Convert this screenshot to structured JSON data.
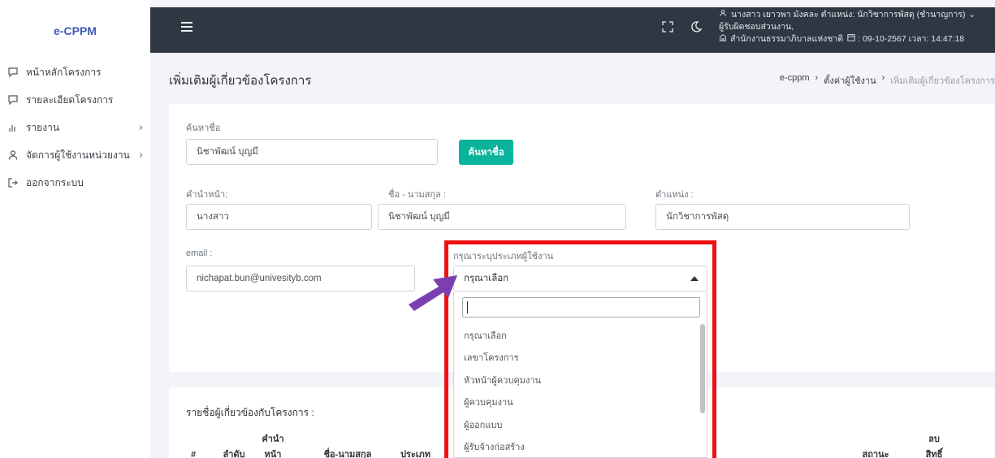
{
  "sidebar": {
    "brand": "e-CPPM",
    "items": [
      {
        "label": "หน้าหลักโครงการ",
        "icon": "chat-icon",
        "chevron": ""
      },
      {
        "label": "รายละเอียดโครงการ",
        "icon": "chat-icon",
        "chevron": ""
      },
      {
        "label": "รายงาน",
        "icon": "bar-chart-icon",
        "chevron": "›"
      },
      {
        "label": "จัดการผู้ใช้งานหน่วยงาน",
        "icon": "user-icon",
        "chevron": "›"
      },
      {
        "label": "ออกจากระบบ",
        "icon": "logout-icon",
        "chevron": ""
      }
    ]
  },
  "topbar": {
    "user_line1": "นางสาว เยาวพา มังคละ ตำแหน่ง: นักวิชาการพัสดุ (ชำนาญการ)",
    "user_line2": "ผู้รับผิดชอบส่วนงาน,",
    "user_line3": "สำนักงานธรรมาภิบาลแห่งชาติ",
    "date": "09-10-2567",
    "time_label": "เวลา: 14:47:18"
  },
  "page": {
    "title": "เพิ่มเติมผู้เกี่ยวข้องโครงการ",
    "breadcrumb": [
      "e-cppm",
      "ตั้งค่าผู้ใช้งาน",
      "เพิ่มเติมผู้เกี่ยวข้องโครงการ"
    ]
  },
  "form": {
    "search_label": "ค้นหาชื่อ",
    "search_value": "นิชาพัฒน์ บุญมี",
    "search_button": "ค้นหาชื่อ",
    "prefix_label": "คำนำหน้า:",
    "prefix_value": "นางสาว",
    "fullname_label": "ชื่อ - นามสกุล :",
    "fullname_value": "นิชาพัฒน์ บุญมี",
    "position_label": "ตำแหน่ง :",
    "position_value": "นักวิชาการพัสดุ",
    "email_label": "email :",
    "email_value": "nichapat.bun@univesityb.com",
    "usertype_label": "กรุณาระบุประเภทผู้ใช้งาน",
    "usertype_selected": "กรุณาเลือก",
    "usertype_options": [
      "กรุณาเลือก",
      "เลขาโครงการ",
      "หัวหน้าผู้ควบคุมงาน",
      "ผู้ควบคุมงาน",
      "ผู้ออกแบบ",
      "ผู้รับจ้างก่อสร้าง"
    ]
  },
  "table": {
    "title": "รายชื่อผู้เกี่ยวข้องกับโครงการ :",
    "headers": {
      "hash": "#",
      "order": "ลำดับ",
      "prefix_a": "คำนำ",
      "prefix_b": "หน้า",
      "name": "ชื่อ-นามสกุล",
      "type": "ประเภท",
      "status": "สถานะ",
      "delete_a": "ลบ",
      "delete_b": "สิทธิ์"
    }
  },
  "colors": {
    "accent": "#0ab39c",
    "topbar": "#2f3743",
    "highlight": "#ee1111",
    "arrow": "#7b3fb0",
    "brand": "#3d5bb5"
  }
}
